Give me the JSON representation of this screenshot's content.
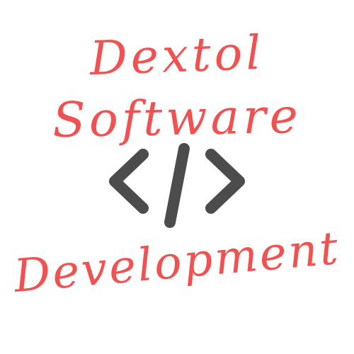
{
  "logo": {
    "line1": "Dextol",
    "line2": "Software",
    "line3": "Development",
    "icon": "code-brackets-icon",
    "colors": {
      "text": "#f05151",
      "icon": "#4c4c4c",
      "background": "#ffffff"
    }
  }
}
